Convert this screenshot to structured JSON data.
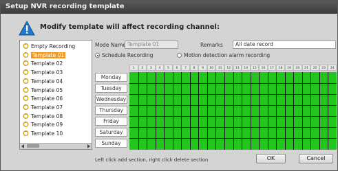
{
  "window": {
    "title": "Setup NVR recording template"
  },
  "warning": {
    "message": "Modify template will affect recording channel:"
  },
  "tree": {
    "items": [
      {
        "label": "Empty Recording",
        "selected": false
      },
      {
        "label": "Template 01",
        "selected": true
      },
      {
        "label": "Template 02",
        "selected": false
      },
      {
        "label": "Template 03",
        "selected": false
      },
      {
        "label": "Template 04",
        "selected": false
      },
      {
        "label": "Template 05",
        "selected": false
      },
      {
        "label": "Template 06",
        "selected": false
      },
      {
        "label": "Template 07",
        "selected": false
      },
      {
        "label": "Template 08",
        "selected": false
      },
      {
        "label": "Template 09",
        "selected": false
      },
      {
        "label": "Template 10",
        "selected": false
      }
    ]
  },
  "form": {
    "name_label": "Mode Name:",
    "name_value": "Template 01",
    "remarks_label": "Remarks",
    "remarks_value": "All date record",
    "radio_schedule": "Schedule Recording",
    "radio_motion": "Motion detection alarm recording",
    "schedule_selected": true
  },
  "schedule": {
    "hours": [
      "1",
      "2",
      "3",
      "4",
      "5",
      "6",
      "7",
      "8",
      "9",
      "10",
      "11",
      "12",
      "13",
      "14",
      "15",
      "16",
      "17",
      "18",
      "19",
      "20",
      "21",
      "22",
      "23",
      "24"
    ],
    "days": [
      "Monday",
      "Tuesday",
      "Wednesday",
      "Thursday",
      "Friday",
      "Saturday",
      "Sunday"
    ],
    "fill_color": "#22c61d"
  },
  "status_text": "Left click add section, right click delete section",
  "buttons": {
    "ok": "OK",
    "cancel": "Cancel"
  }
}
